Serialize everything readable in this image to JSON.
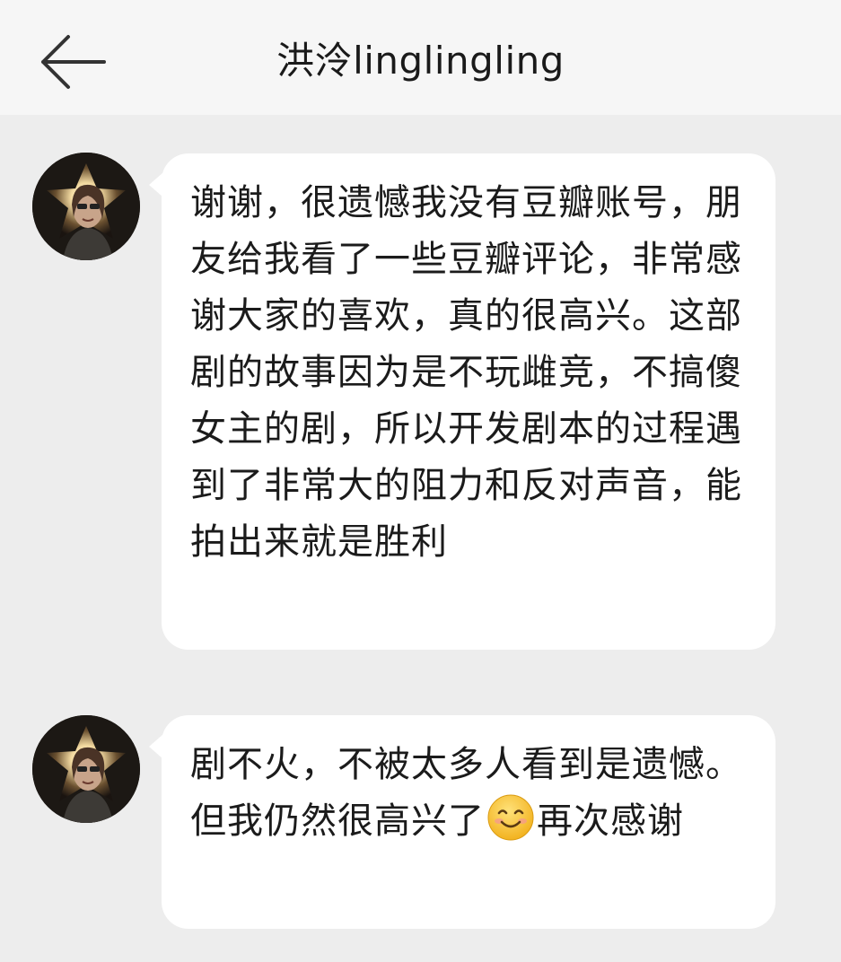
{
  "header": {
    "title": "洪泠linglingling",
    "back_icon": "back-arrow-icon"
  },
  "messages": [
    {
      "sender": "洪泠linglingling",
      "text": "谢谢，很遗憾我没有豆瓣账号，朋友给我看了一些豆瓣评论，非常感谢大家的喜欢，真的很高兴。这部剧的故事因为是不玩雌竞，不搞傻女主的剧，所以开发剧本的过程遇到了非常大的阻力和反对声音，能拍出来就是胜利"
    },
    {
      "sender": "洪泠linglingling",
      "text_before_emoji": "剧不火，不被太多人看到是遗憾。但我仍然很高兴了",
      "emoji": "smiling-face-emoji",
      "text_after_emoji": "再次感谢"
    }
  ],
  "colors": {
    "background": "#ededed",
    "header": "#f6f6f6",
    "bubble": "#ffffff",
    "text": "#1b1b1b"
  }
}
